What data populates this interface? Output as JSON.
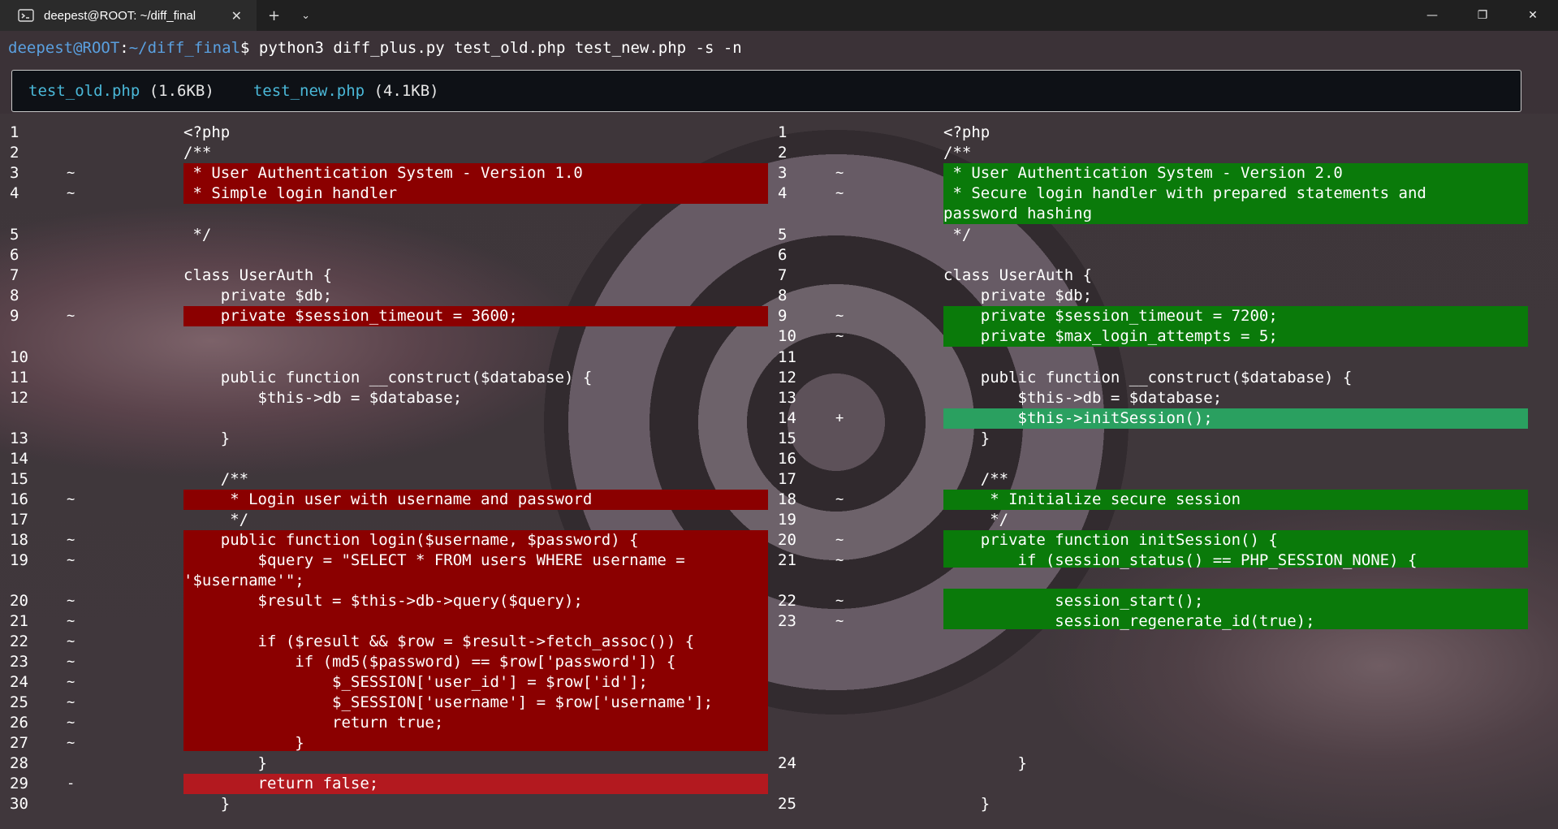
{
  "tab": {
    "title": "deepest@ROOT: ~/diff_final",
    "icon": "terminal-icon"
  },
  "prompt": {
    "user": "deepest@ROOT",
    "path": "~/diff_final",
    "command": "$ python3 diff_plus.py test_old.php test_new.php -s -n"
  },
  "files": {
    "old_name": "test_old.php",
    "old_size": "(1.6KB)",
    "new_name": "test_new.php",
    "new_size": "(4.1KB)"
  },
  "left": [
    {
      "n": "1",
      "m": "",
      "t": "<?php"
    },
    {
      "n": "2",
      "m": "",
      "t": "/**"
    },
    {
      "n": "3",
      "m": "~",
      "t": " * User Authentication System - Version 1.0"
    },
    {
      "n": "4",
      "m": "~",
      "t": " * Simple login handler"
    },
    {
      "n": "5",
      "m": "",
      "t": " */"
    },
    {
      "n": "6",
      "m": "",
      "t": ""
    },
    {
      "n": "7",
      "m": "",
      "t": "class UserAuth {"
    },
    {
      "n": "8",
      "m": "",
      "t": "    private $db;"
    },
    {
      "n": "9",
      "m": "~",
      "t": "    private $session_timeout = 3600;"
    },
    {
      "n": "10",
      "m": "",
      "t": ""
    },
    {
      "n": "11",
      "m": "",
      "t": "    public function __construct($database) {"
    },
    {
      "n": "12",
      "m": "",
      "t": "        $this->db = $database;"
    },
    {
      "n": "13",
      "m": "",
      "t": "    }"
    },
    {
      "n": "14",
      "m": "",
      "t": ""
    },
    {
      "n": "15",
      "m": "",
      "t": "    /**"
    },
    {
      "n": "16",
      "m": "~",
      "t": "     * Login user with username and password"
    },
    {
      "n": "17",
      "m": "",
      "t": "     */"
    },
    {
      "n": "18",
      "m": "~",
      "t": "    public function login($username, $password) {"
    },
    {
      "n": "19",
      "m": "~",
      "t": "        $query = \"SELECT * FROM users WHERE username ="
    },
    {
      "n": "",
      "m": "",
      "t": "'$username'\";"
    },
    {
      "n": "20",
      "m": "~",
      "t": "        $result = $this->db->query($query);"
    },
    {
      "n": "21",
      "m": "~",
      "t": ""
    },
    {
      "n": "22",
      "m": "~",
      "t": "        if ($result && $row = $result->fetch_assoc()) {"
    },
    {
      "n": "23",
      "m": "~",
      "t": "            if (md5($password) == $row['password']) {"
    },
    {
      "n": "24",
      "m": "~",
      "t": "                $_SESSION['user_id'] = $row['id'];"
    },
    {
      "n": "25",
      "m": "~",
      "t": "                $_SESSION['username'] = $row['username'];"
    },
    {
      "n": "26",
      "m": "~",
      "t": "                return true;"
    },
    {
      "n": "27",
      "m": "~",
      "t": "            }"
    },
    {
      "n": "28",
      "m": "",
      "t": "        }"
    },
    {
      "n": "29",
      "m": "-",
      "t": "        return false;"
    },
    {
      "n": "30",
      "m": "",
      "t": "    }"
    }
  ],
  "right": [
    {
      "n": "1",
      "m": "",
      "t": "<?php"
    },
    {
      "n": "2",
      "m": "",
      "t": "/**"
    },
    {
      "n": "3",
      "m": "~",
      "t": " * User Authentication System - Version 2.0"
    },
    {
      "n": "4",
      "m": "~",
      "t": " * Secure login handler with prepared statements and"
    },
    {
      "n": "",
      "m": "",
      "t": "password hashing"
    },
    {
      "n": "5",
      "m": "",
      "t": " */"
    },
    {
      "n": "6",
      "m": "",
      "t": ""
    },
    {
      "n": "7",
      "m": "",
      "t": "class UserAuth {"
    },
    {
      "n": "8",
      "m": "",
      "t": "    private $db;"
    },
    {
      "n": "9",
      "m": "~",
      "t": "    private $session_timeout = 7200;"
    },
    {
      "n": "10",
      "m": "~",
      "t": "    private $max_login_attempts = 5;"
    },
    {
      "n": "11",
      "m": "",
      "t": ""
    },
    {
      "n": "12",
      "m": "",
      "t": "    public function __construct($database) {"
    },
    {
      "n": "13",
      "m": "",
      "t": "        $this->db = $database;"
    },
    {
      "n": "14",
      "m": "+",
      "t": "        $this->initSession();"
    },
    {
      "n": "15",
      "m": "",
      "t": "    }"
    },
    {
      "n": "16",
      "m": "",
      "t": ""
    },
    {
      "n": "17",
      "m": "",
      "t": "    /**"
    },
    {
      "n": "18",
      "m": "~",
      "t": "     * Initialize secure session"
    },
    {
      "n": "19",
      "m": "",
      "t": "     */"
    },
    {
      "n": "20",
      "m": "~",
      "t": "    private function initSession() {"
    },
    {
      "n": "21",
      "m": "~",
      "t": "        if (session_status() == PHP_SESSION_NONE) {"
    },
    {
      "n": "22",
      "m": "~",
      "t": "            session_start();"
    },
    {
      "n": "23",
      "m": "~",
      "t": "            session_regenerate_id(true);"
    },
    {
      "n": "24",
      "m": "",
      "t": "        }"
    },
    {
      "n": "25",
      "m": "",
      "t": "    }"
    }
  ],
  "colors": {
    "removed": "#8b0000",
    "removed_strong": "#b3191f",
    "added": "#0a7a0a",
    "added_strong": "#2aa060"
  }
}
